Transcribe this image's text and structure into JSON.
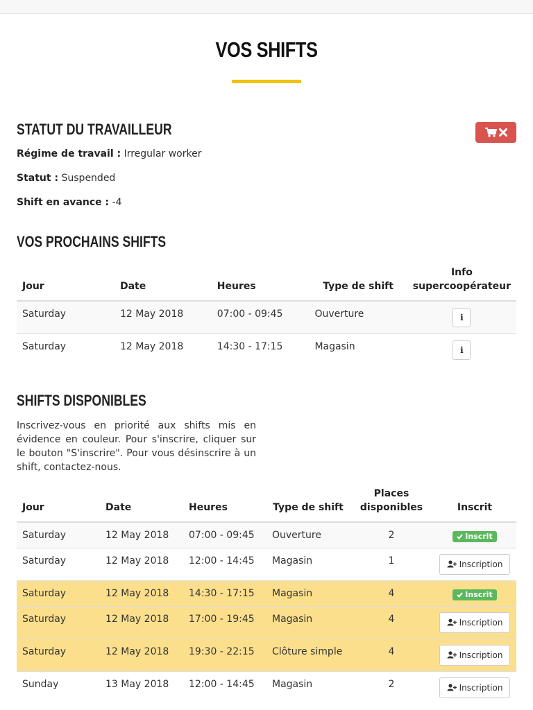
{
  "page": {
    "title": "VOS SHIFTS"
  },
  "statut": {
    "heading": "STATUT DU TRAVAILLEUR",
    "regime_label": "Régime de travail :",
    "regime_value": "Irregular worker",
    "statut_label": "Statut :",
    "statut_value": "Suspended",
    "avance_label": "Shift en avance :",
    "avance_value": "-4",
    "cart_icon": "cart-icon",
    "close_icon": "times-icon",
    "accent": "#d9534f"
  },
  "prochains": {
    "heading": "VOS PROCHAINS SHIFTS",
    "headers": [
      "Jour",
      "Date",
      "Heures",
      "Type de shift",
      "Info supercoopérateur"
    ],
    "rows": [
      {
        "jour": "Saturday",
        "date": "12 May 2018",
        "heures": "07:00 - 09:45",
        "type": "Ouverture",
        "info": "i"
      },
      {
        "jour": "Saturday",
        "date": "12 May 2018",
        "heures": "14:30 - 17:15",
        "type": "Magasin",
        "info": "i"
      }
    ]
  },
  "disponibles": {
    "heading": "SHIFTS DISPONIBLES",
    "description": "Inscrivez-vous en priorité aux shifts mis en évidence en couleur. Pour s'inscrire, cliquer sur le bouton \"S'inscrire\". Pour vous désinscrire à un shift, contactez-nous.",
    "headers": [
      "Jour",
      "Date",
      "Heures",
      "Type de shift",
      "Places disponibles",
      "Inscrit"
    ],
    "inscrit_label": "Inscrit",
    "inscription_label": "Inscription",
    "highlight_color": "#fcdf8c",
    "rows": [
      {
        "jour": "Saturday",
        "date": "12 May 2018",
        "heures": "07:00 - 09:45",
        "type": "Ouverture",
        "places": "2",
        "inscrit": true,
        "highlight": false
      },
      {
        "jour": "Saturday",
        "date": "12 May 2018",
        "heures": "12:00 - 14:45",
        "type": "Magasin",
        "places": "1",
        "inscrit": false,
        "highlight": false
      },
      {
        "jour": "Saturday",
        "date": "12 May 2018",
        "heures": "14:30 - 17:15",
        "type": "Magasin",
        "places": "4",
        "inscrit": true,
        "highlight": true
      },
      {
        "jour": "Saturday",
        "date": "12 May 2018",
        "heures": "17:00 - 19:45",
        "type": "Magasin",
        "places": "4",
        "inscrit": false,
        "highlight": true
      },
      {
        "jour": "Saturday",
        "date": "12 May 2018",
        "heures": "19:30 - 22:15",
        "type": "Clôture simple",
        "places": "4",
        "inscrit": false,
        "highlight": true
      },
      {
        "jour": "Sunday",
        "date": "13 May 2018",
        "heures": "12:00 - 14:45",
        "type": "Magasin",
        "places": "2",
        "inscrit": false,
        "highlight": false
      }
    ]
  }
}
